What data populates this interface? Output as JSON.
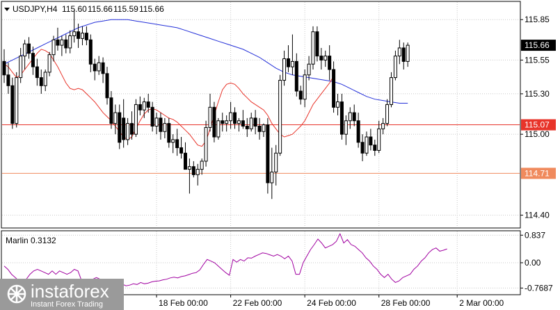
{
  "chart_data": [
    {
      "type": "candlestick",
      "panel": "main",
      "title": "USDJPY,H4",
      "ohlc_header": [
        "115.60",
        "115.66",
        "115.59",
        "115.66"
      ],
      "price_ticks": [
        "115.85",
        "115.55",
        "115.30",
        "115.00",
        "114.40"
      ],
      "price_tick_values": [
        115.85,
        115.55,
        115.3,
        115.0,
        114.4
      ],
      "ylim": [
        114.31,
        115.98
      ],
      "current_price": {
        "label": "115.66",
        "value": 115.66,
        "color": "#000000"
      },
      "levels": [
        {
          "label": "115.07",
          "value": 115.07,
          "color": "#e8342a"
        },
        {
          "label": "114.71",
          "value": 114.71,
          "color": "#f08a5d"
        }
      ],
      "x_labels": [
        {
          "label": "18 Feb 00:00",
          "bar": 37
        },
        {
          "label": "22 Feb 00:00",
          "bar": 55
        },
        {
          "label": "24 Feb 00:00",
          "bar": 73
        },
        {
          "label": "28 Feb 00:00",
          "bar": 91
        },
        {
          "label": "2 Mar 00:00",
          "bar": 110
        }
      ],
      "colors": {
        "up": "#ffffff",
        "down": "#000000",
        "wick": "#000000",
        "ma_fast": "#e8342a",
        "ma_slow": "#2430d9",
        "grid": "#c8c8c8"
      },
      "candles": [
        [
          115.54,
          115.63,
          115.38,
          115.44
        ],
        [
          115.44,
          115.53,
          115.3,
          115.36
        ],
        [
          115.36,
          115.42,
          115.04,
          115.08
        ],
        [
          115.08,
          115.46,
          115.05,
          115.42
        ],
        [
          115.42,
          115.64,
          115.38,
          115.58
        ],
        [
          115.58,
          115.7,
          115.48,
          115.67
        ],
        [
          115.67,
          115.72,
          115.56,
          115.6
        ],
        [
          115.6,
          115.65,
          115.44,
          115.5
        ],
        [
          115.5,
          115.56,
          115.36,
          115.42
        ],
        [
          115.42,
          115.48,
          115.3,
          115.36
        ],
        [
          115.36,
          115.48,
          115.32,
          115.46
        ],
        [
          115.46,
          115.61,
          115.43,
          115.59
        ],
        [
          115.59,
          115.73,
          115.54,
          115.7
        ],
        [
          115.7,
          115.79,
          115.62,
          115.66
        ],
        [
          115.66,
          115.73,
          115.58,
          115.7
        ],
        [
          115.7,
          115.74,
          115.6,
          115.64
        ],
        [
          115.64,
          115.77,
          115.6,
          115.73
        ],
        [
          115.73,
          115.92,
          115.68,
          115.76
        ],
        [
          115.76,
          115.82,
          115.64,
          115.71
        ],
        [
          115.71,
          115.8,
          115.66,
          115.75
        ],
        [
          115.75,
          115.8,
          115.66,
          115.7
        ],
        [
          115.7,
          115.74,
          115.46,
          115.52
        ],
        [
          115.52,
          115.56,
          115.4,
          115.47
        ],
        [
          115.47,
          115.58,
          115.44,
          115.53
        ],
        [
          115.53,
          115.57,
          115.38,
          115.45
        ],
        [
          115.45,
          115.5,
          115.22,
          115.27
        ],
        [
          115.27,
          115.32,
          115.04,
          115.08
        ],
        [
          115.08,
          115.22,
          115.0,
          115.16
        ],
        [
          115.16,
          115.22,
          114.89,
          114.94
        ],
        [
          115.12,
          115.26,
          114.9,
          114.96
        ],
        [
          114.96,
          115.12,
          114.92,
          115.08
        ],
        [
          115.08,
          115.17,
          114.96,
          115.0
        ],
        [
          115.0,
          115.26,
          114.98,
          115.22
        ],
        [
          115.22,
          115.28,
          115.14,
          115.18
        ],
        [
          115.18,
          115.27,
          115.12,
          115.24
        ],
        [
          115.24,
          115.3,
          115.16,
          115.2
        ],
        [
          115.2,
          115.24,
          115.02,
          115.06
        ],
        [
          115.06,
          115.16,
          115.0,
          115.12
        ],
        [
          115.12,
          115.16,
          114.96,
          115.02
        ],
        [
          115.02,
          115.12,
          114.97,
          115.08
        ],
        [
          115.08,
          115.12,
          114.9,
          114.94
        ],
        [
          114.94,
          115.0,
          114.86,
          114.96
        ],
        [
          114.96,
          115.04,
          114.84,
          114.9
        ],
        [
          114.9,
          114.98,
          114.82,
          114.86
        ],
        [
          114.86,
          114.94,
          114.8,
          114.74
        ],
        [
          114.74,
          114.82,
          114.56,
          114.76
        ],
        [
          114.76,
          114.8,
          114.68,
          114.7
        ],
        [
          114.7,
          114.78,
          114.62,
          114.74
        ],
        [
          114.74,
          114.82,
          114.7,
          114.8
        ],
        [
          114.8,
          115.1,
          114.76,
          115.05
        ],
        [
          115.05,
          115.3,
          115.02,
          115.2
        ],
        [
          115.2,
          115.24,
          114.94,
          114.98
        ],
        [
          114.98,
          115.12,
          114.96,
          115.1
        ],
        [
          115.1,
          115.16,
          115.02,
          115.08
        ],
        [
          115.08,
          115.14,
          115.02,
          115.1
        ],
        [
          115.1,
          115.24,
          115.04,
          115.16
        ],
        [
          115.16,
          115.2,
          115.04,
          115.08
        ],
        [
          115.08,
          115.12,
          115.02,
          115.1
        ],
        [
          115.1,
          115.18,
          115.04,
          115.06
        ],
        [
          115.06,
          115.12,
          114.98,
          115.04
        ],
        [
          115.04,
          115.16,
          115.02,
          115.12
        ],
        [
          115.12,
          115.18,
          115.0,
          115.06
        ],
        [
          115.06,
          115.12,
          114.96,
          115.02
        ],
        [
          115.02,
          115.08,
          114.98,
          115.07
        ],
        [
          115.07,
          115.12,
          114.56,
          114.64
        ],
        [
          114.64,
          114.9,
          114.52,
          114.72
        ],
        [
          114.72,
          114.92,
          114.62,
          114.86
        ],
        [
          114.86,
          115.44,
          114.84,
          115.4
        ],
        [
          115.4,
          115.62,
          115.36,
          115.56
        ],
        [
          115.56,
          115.66,
          115.46,
          115.5
        ],
        [
          115.5,
          115.74,
          115.44,
          115.54
        ],
        [
          115.54,
          115.6,
          115.28,
          115.32
        ],
        [
          115.32,
          115.36,
          115.22,
          115.26
        ],
        [
          115.26,
          115.48,
          115.2,
          115.44
        ],
        [
          115.44,
          115.58,
          115.4,
          115.52
        ],
        [
          115.52,
          115.8,
          115.48,
          115.76
        ],
        [
          115.76,
          115.8,
          115.54,
          115.58
        ],
        [
          115.58,
          115.64,
          115.48,
          115.55
        ],
        [
          115.55,
          115.62,
          115.5,
          115.58
        ],
        [
          115.58,
          115.66,
          115.4,
          115.48
        ],
        [
          115.48,
          115.54,
          115.16,
          115.2
        ],
        [
          115.2,
          115.3,
          115.14,
          115.24
        ],
        [
          115.24,
          115.3,
          114.96,
          115.0
        ],
        [
          115.0,
          115.14,
          114.92,
          115.1
        ],
        [
          115.1,
          115.2,
          115.04,
          115.16
        ],
        [
          115.16,
          115.22,
          115.06,
          115.1
        ],
        [
          115.1,
          115.16,
          114.9,
          114.94
        ],
        [
          114.94,
          115.0,
          114.8,
          114.86
        ],
        [
          114.86,
          115.02,
          114.84,
          114.98
        ],
        [
          114.98,
          115.04,
          114.88,
          114.92
        ],
        [
          114.92,
          114.96,
          114.84,
          114.88
        ],
        [
          114.88,
          115.1,
          114.86,
          115.04
        ],
        [
          115.04,
          115.12,
          115.0,
          115.08
        ],
        [
          115.08,
          115.26,
          115.06,
          115.22
        ],
        [
          115.22,
          115.46,
          115.2,
          115.42
        ],
        [
          115.42,
          115.62,
          115.4,
          115.58
        ],
        [
          115.58,
          115.7,
          115.52,
          115.64
        ],
        [
          115.64,
          115.68,
          115.48,
          115.54
        ],
        [
          115.54,
          115.68,
          115.5,
          115.66
        ]
      ],
      "ma_fast": [
        115.52,
        115.5,
        115.46,
        115.42,
        115.44,
        115.48,
        115.52,
        115.56,
        115.6,
        115.63,
        115.62,
        115.6,
        115.55,
        115.5,
        115.44,
        115.38,
        115.34,
        115.33,
        115.34,
        115.33,
        115.3,
        115.27,
        115.24,
        115.2,
        115.16,
        115.13,
        115.1,
        115.06,
        115.02,
        114.98,
        114.96,
        114.98,
        115.04,
        115.1,
        115.15,
        115.18,
        115.19,
        115.18,
        115.16,
        115.14,
        115.12,
        115.11,
        115.09,
        115.06,
        115.03,
        115.0,
        114.96,
        114.92,
        114.91,
        114.95,
        115.04,
        115.14,
        115.24,
        115.33,
        115.37,
        115.38,
        115.37,
        115.34,
        115.3,
        115.27,
        115.24,
        115.22,
        115.2,
        115.18,
        115.14,
        115.08,
        115.04,
        115.0,
        114.98,
        114.99,
        115.0,
        115.03,
        115.06,
        115.1,
        115.16,
        115.22,
        115.26,
        115.3,
        115.34,
        115.38,
        115.43
      ],
      "ma_fast_start": 0,
      "ma_slow": [
        115.52,
        115.55,
        115.58,
        115.61,
        115.64,
        115.67,
        115.7,
        115.73,
        115.76,
        115.79,
        115.81,
        115.83,
        115.84,
        115.85,
        115.85,
        115.85,
        115.84,
        115.83,
        115.82,
        115.81,
        115.8,
        115.79,
        115.77,
        115.75,
        115.73,
        115.71,
        115.69,
        115.67,
        115.65,
        115.63,
        115.6,
        115.57,
        115.53,
        115.49,
        115.46,
        115.44,
        115.43,
        115.42,
        115.41,
        115.4,
        115.39,
        115.37,
        115.34,
        115.31,
        115.28,
        115.26,
        115.25,
        115.24,
        115.23,
        115.23
      ],
      "ma_slow_step": 2
    },
    {
      "type": "line",
      "panel": "indicator",
      "title": "Marlin 0.3132",
      "ticks": [
        "0.837",
        "0.00",
        "-0.7687"
      ],
      "tick_values": [
        0.837,
        0.0,
        -0.7687
      ],
      "ylim": [
        -0.95,
        0.95
      ],
      "color": "#a000a0",
      "values": [
        -0.1,
        -0.2,
        -0.35,
        -0.45,
        -0.55,
        -0.6,
        -0.5,
        -0.35,
        -0.25,
        -0.2,
        -0.25,
        -0.3,
        -0.35,
        -0.25,
        -0.35,
        -0.25,
        -0.3,
        -0.35,
        -0.3,
        -0.2,
        -0.25,
        -0.55,
        -0.6,
        -0.55,
        -0.5,
        -0.45,
        -0.5,
        -0.55,
        -0.6,
        -0.7,
        -0.75,
        -0.7,
        -0.65,
        -0.7,
        -0.68,
        -0.64,
        -0.66,
        -0.6,
        -0.64,
        -0.62,
        -0.58,
        -0.56,
        -0.55,
        -0.52,
        -0.5,
        -0.46,
        -0.44,
        -0.46,
        -0.42,
        -0.4,
        -0.36,
        -0.32,
        -0.3,
        -0.22,
        -0.05,
        0.1,
        0.05,
        0.0,
        -0.1,
        -0.2,
        -0.3,
        -0.38,
        0.1,
        0.02,
        0.1,
        0.05,
        0.15,
        0.14,
        0.2,
        0.25,
        0.3,
        0.28,
        0.24,
        0.2,
        0.25,
        0.2,
        0.12,
        0.2,
        0.05,
        -0.35,
        -0.35,
        0.0,
        0.2,
        0.4,
        0.55,
        0.72,
        0.6,
        0.45,
        0.5,
        0.55,
        0.65,
        0.88,
        0.6,
        0.7,
        0.55,
        0.5,
        0.4,
        0.3,
        0.15,
        0.05,
        -0.1,
        -0.2,
        -0.35,
        -0.45,
        -0.35,
        -0.5,
        -0.6,
        -0.55,
        -0.45,
        -0.4,
        -0.35,
        -0.2,
        -0.1,
        0.05,
        0.15,
        0.3,
        0.4,
        0.45,
        0.35,
        0.38,
        0.42
      ]
    }
  ],
  "watermark": {
    "brand": "instaforex",
    "tagline": "Instant Forex Trading"
  }
}
